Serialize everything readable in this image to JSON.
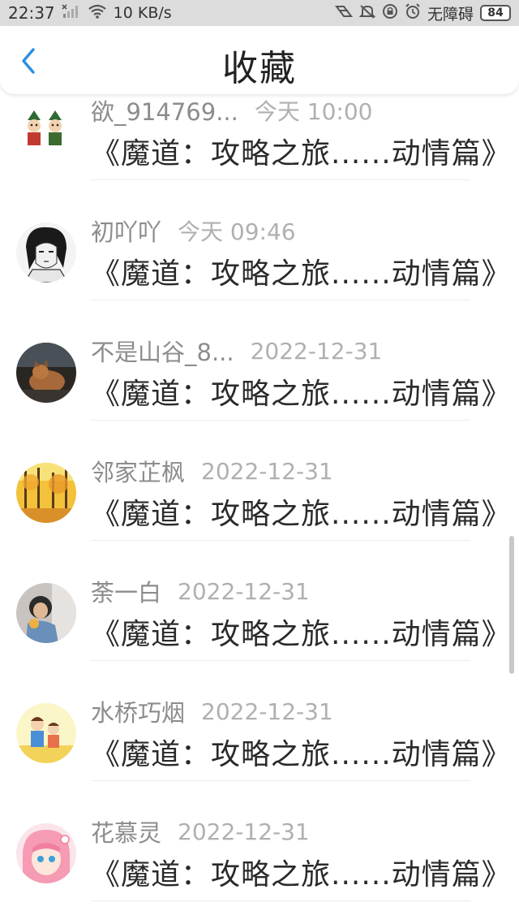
{
  "status_bar": {
    "time": "22:37",
    "net_speed": "10 KB/s",
    "accessibility": "无障碍",
    "battery": "84",
    "icons": [
      "signal-off-icon",
      "wifi-icon",
      "hd-icon",
      "mute-icon",
      "vpn-icon",
      "alarm-icon"
    ]
  },
  "header": {
    "title": "收藏",
    "back_icon": "chevron-left-icon",
    "accent_color": "#2a8fe0"
  },
  "items": [
    {
      "username": "欲_914769...",
      "date": "今天 10:00",
      "title": "《魔道：攻略之旅......动情篇》",
      "avatar": "cartoon-couple"
    },
    {
      "username": "初吖吖",
      "date": "今天 09:46",
      "title": "《魔道：攻略之旅......动情篇》",
      "avatar": "sketch-portrait"
    },
    {
      "username": "不是山谷_8...",
      "date": "2022-12-31",
      "title": "《魔道：攻略之旅......动情篇》",
      "avatar": "dog-photo"
    },
    {
      "username": "邻家芷枫",
      "date": "2022-12-31",
      "title": "《魔道：攻略之旅......动情篇》",
      "avatar": "autumn-trees"
    },
    {
      "username": "荼一白",
      "date": "2022-12-31",
      "title": "《魔道：攻略之旅......动情篇》",
      "avatar": "person-photo"
    },
    {
      "username": "水桥巧烟",
      "date": "2022-12-31",
      "title": "《魔道：攻略之旅......动情篇》",
      "avatar": "cartoon-kids"
    },
    {
      "username": "花慕灵",
      "date": "2022-12-31",
      "title": "《魔道：攻略之旅......动情篇》",
      "avatar": "pink-anime-girl"
    }
  ]
}
